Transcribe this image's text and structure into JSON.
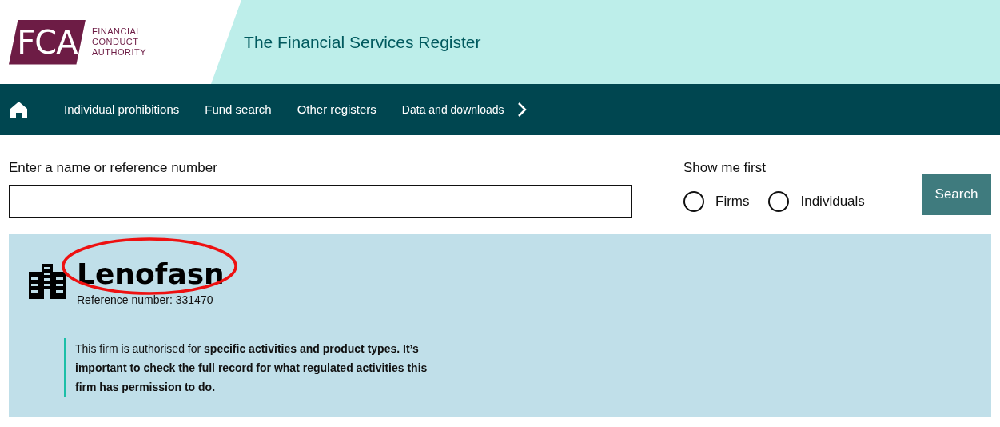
{
  "header": {
    "logo_letters": "FCA",
    "logo_words": [
      "FINANCIAL",
      "CONDUCT",
      "AUTHORITY"
    ],
    "title": "The Financial Services Register"
  },
  "nav": {
    "items": [
      {
        "label": "Individual prohibitions"
      },
      {
        "label": "Fund search"
      },
      {
        "label": "Other registers"
      },
      {
        "label": "Data and downloads"
      }
    ]
  },
  "search": {
    "label": "Enter a name or reference number",
    "show_me_first": "Show me first",
    "options": [
      {
        "label": "Firms",
        "selected": false
      },
      {
        "label": "Individuals",
        "selected": false
      }
    ],
    "button": "Search"
  },
  "result": {
    "name": "Lenofasn",
    "reference": "Reference number: 331470",
    "notice": "This firm is authorised for **specific activities and product types. It’s important to check the full record for what regulated activities this firm has permission to do.**"
  }
}
